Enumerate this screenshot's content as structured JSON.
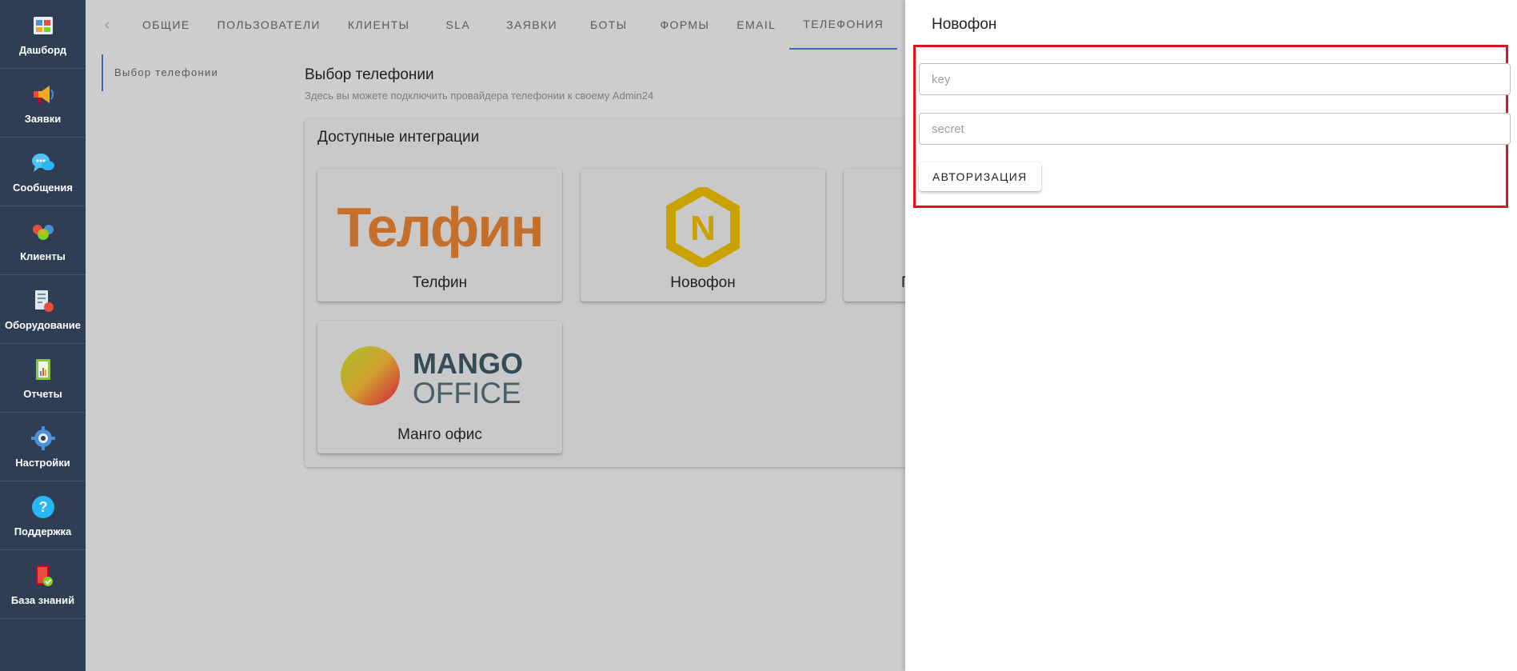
{
  "sidebar": {
    "items": [
      {
        "label": "Дашборд",
        "icon": "dashboard-icon"
      },
      {
        "label": "Заявки",
        "icon": "megaphone-icon"
      },
      {
        "label": "Сообщения",
        "icon": "chat-icon"
      },
      {
        "label": "Клиенты",
        "icon": "clients-icon"
      },
      {
        "label": "Оборудование",
        "icon": "equipment-icon"
      },
      {
        "label": "Отчеты",
        "icon": "reports-icon"
      },
      {
        "label": "Настройки",
        "icon": "gear-icon"
      },
      {
        "label": "Поддержка",
        "icon": "help-icon"
      },
      {
        "label": "База знаний",
        "icon": "knowledge-base-icon"
      }
    ]
  },
  "tabs": [
    "Общие",
    "Пользователи",
    "Клиенты",
    "SLA",
    "Заявки",
    "Боты",
    "Формы",
    "Email",
    "Телефония"
  ],
  "active_tab": "Телефония",
  "subnav": {
    "label": "Выбор телефонии"
  },
  "page": {
    "title": "Выбор телефонии",
    "subtitle": "Здесь вы можете подключить провайдера телефонии к своему Admin24"
  },
  "integrations": {
    "title": "Доступные интеграции",
    "cards": [
      {
        "label": "Телфин",
        "logo_text": "Телфин"
      },
      {
        "label": "Новофон",
        "logo_text": "N"
      },
      {
        "label": "П"
      },
      {
        "label": "Манго офис",
        "logo_text_1": "MANGO",
        "logo_text_2": "OFFICE"
      }
    ]
  },
  "drawer": {
    "title": "Новофон",
    "key_placeholder": "key",
    "secret_placeholder": "secret",
    "auth_button": "Авторизация"
  },
  "colors": {
    "sidebar_bg": "#2f3e55",
    "highlight_border": "#e0141e",
    "telfin_orange": "#c46f2c",
    "novofon_yellow": "#c9a100",
    "mango_text": "#344a55"
  }
}
